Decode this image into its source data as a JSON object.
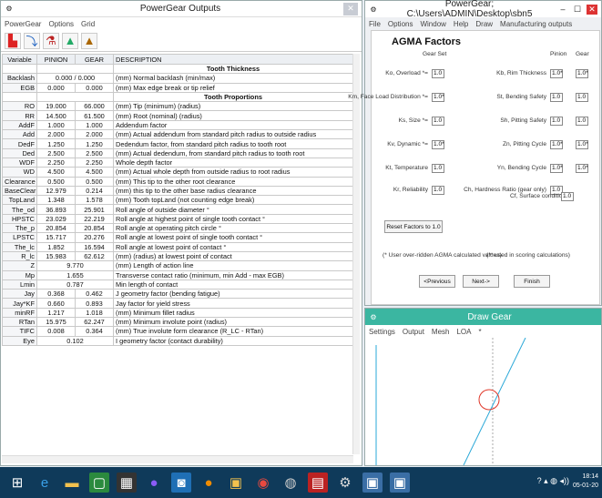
{
  "outputs_window": {
    "title": "PowerGear Outputs",
    "menu": [
      "PowerGear",
      "Options",
      "Grid"
    ],
    "toolbar_icons": [
      "gear-view-icon",
      "export-icon",
      "flask-icon",
      "tooth-chart-icon",
      "tooth-alt-icon"
    ],
    "columns": [
      "Variable",
      "PINION",
      "GEAR",
      "DESCRIPTION"
    ],
    "rows": [
      {
        "type": "section",
        "text": "Tooth Thickness"
      },
      {
        "var": "Backlash",
        "pinion": "0.000 / 0.000",
        "gear": "",
        "desc": "(mm) Normal backlash (min/max)",
        "span": true
      },
      {
        "var": "EGB",
        "pinion": "0.000",
        "gear": "0.000",
        "desc": "(mm) Max edge break or tip relief"
      },
      {
        "type": "section",
        "text": "Tooth Proportions"
      },
      {
        "var": "RO",
        "pinion": "19.000",
        "gear": "66.000",
        "desc": "(mm) Tip (minimum) (radius)"
      },
      {
        "var": "RR",
        "pinion": "14.500",
        "gear": "61.500",
        "desc": "(mm) Root (nominal) (radius)"
      },
      {
        "var": "AddF",
        "pinion": "1.000",
        "gear": "1.000",
        "desc": "Addendum factor"
      },
      {
        "var": "Add",
        "pinion": "2.000",
        "gear": "2.000",
        "desc": "(mm) Actual addendum from standard pitch radius to outside radius"
      },
      {
        "var": "DedF",
        "pinion": "1.250",
        "gear": "1.250",
        "desc": "Dedendum factor, from standard pitch radius to tooth root"
      },
      {
        "var": "Ded",
        "pinion": "2.500",
        "gear": "2.500",
        "desc": "(mm) Actual dedendum, from standard pitch radius to tooth root"
      },
      {
        "var": "WDF",
        "pinion": "2.250",
        "gear": "2.250",
        "desc": "Whole depth factor"
      },
      {
        "var": "WD",
        "pinion": "4.500",
        "gear": "4.500",
        "desc": "(mm) Actual whole depth from outside radius to root radius"
      },
      {
        "var": "Clearance",
        "pinion": "0.500",
        "gear": "0.500",
        "desc": "(mm) This tip to the other root clearance"
      },
      {
        "var": "BaseClear",
        "pinion": "12.979",
        "gear": "0.214",
        "desc": "(mm) this tip to the other base radius clearance"
      },
      {
        "var": "TopLand",
        "pinion": "1.348",
        "gear": "1.578",
        "desc": "(mm) Tooth topLand (not counting edge break)"
      },
      {
        "var": "The_od",
        "pinion": "36.893",
        "gear": "25.901",
        "desc": "Roll angle of outside diameter °"
      },
      {
        "var": "HPSTC",
        "pinion": "23.029",
        "gear": "22.219",
        "desc": "Roll angle at highest point of single tooth contact °"
      },
      {
        "var": "The_p",
        "pinion": "20.854",
        "gear": "20.854",
        "desc": "Roll angle at operating pitch circle °"
      },
      {
        "var": "LPSTC",
        "pinion": "15.717",
        "gear": "20.276",
        "desc": "Roll angle at lowest point of single tooth contact °"
      },
      {
        "var": "The_lc",
        "pinion": "1.852",
        "gear": "16.594",
        "desc": "Roll angle at lowest point of contact °"
      },
      {
        "var": "R_lc",
        "pinion": "15.983",
        "gear": "62.612",
        "desc": "(mm) (radius) at lowest point of contact"
      },
      {
        "var": "Z",
        "pinion": "9.770",
        "gear": "",
        "desc": "(mm) Length of action line",
        "span": true
      },
      {
        "var": "Mp",
        "pinion": "1.655",
        "gear": "",
        "desc": "Transverse contact ratio (minimum, min Add - max EGB)",
        "span": true
      },
      {
        "var": "Lmin",
        "pinion": "0.787",
        "gear": "",
        "desc": "Min length of contact",
        "span": true
      },
      {
        "var": "Jay",
        "pinion": "0.368",
        "gear": "0.462",
        "desc": "J geometry factor (bending fatigue)"
      },
      {
        "var": "Jay*KF",
        "pinion": "0.660",
        "gear": "0.893",
        "desc": "Jay factor for yield stress"
      },
      {
        "var": "minRF",
        "pinion": "1.217",
        "gear": "1.018",
        "desc": "(mm) Minimum fillet radius"
      },
      {
        "var": "RTan",
        "pinion": "15.975",
        "gear": "62.247",
        "desc": "(mm) Minimum involute point (radius)"
      },
      {
        "var": "TIFC",
        "pinion": "0.008",
        "gear": "0.364",
        "desc": "(mm) True involute form clearance (R_LC - RTan)"
      },
      {
        "var": "Eye",
        "pinion": "0.102",
        "gear": "",
        "desc": "I geometry factor (contact durability)",
        "span": true
      }
    ]
  },
  "agma_window": {
    "title": "PowerGear;  C:\\Users\\ADMIN\\Desktop\\sbn5",
    "menu": [
      "File",
      "Options",
      "Window",
      "Help",
      "Draw",
      "Manufacturing outputs"
    ],
    "heading": "AGMA Factors",
    "col_gear_set": "Gear Set",
    "col_pinion": "Pinion",
    "col_gear": "Gear",
    "left_fields": [
      {
        "label": "Ko, Overload *=",
        "value": "1.0"
      },
      {
        "label": "Km, Face Load Distribution *=",
        "value": "1.0*"
      },
      {
        "label": "Ks, Size *=",
        "value": "1.0"
      },
      {
        "label": "Kv, Dynamic *=",
        "value": "1.0*"
      },
      {
        "label": "Kt, Temperature",
        "value": "1.0"
      },
      {
        "label": "Kr, Reliability",
        "value": "1.0"
      }
    ],
    "right_fields": [
      {
        "label": "Kb, Rim Thickness",
        "pinion": "1.0*",
        "gear": "1.0*"
      },
      {
        "label": "St, Bending Safety",
        "pinion": "1.0",
        "gear": "1.0"
      },
      {
        "label": "Sh, Pitting Safety",
        "pinion": "1.0",
        "gear": "1.0"
      },
      {
        "label": "Zn, Pitting Cycle",
        "pinion": "1.0*",
        "gear": "1.0*"
      },
      {
        "label": "Yn, Bending Cycle",
        "pinion": "1.0*",
        "gear": "1.0*"
      },
      {
        "label": "Ch, Hardness Ratio (gear only)",
        "pinion": "1.0",
        "gear": ""
      }
    ],
    "cf_label": "Cf, Surface condition **",
    "cf_value": "1.0",
    "reset_label": "Reset Factors to 1.0",
    "note1": "(* User over-ridden AGMA calculated values)",
    "note2": "(** used in scoring calculations)",
    "prev_label": "<Previous",
    "next_label": "Next->",
    "finish_label": "Finish"
  },
  "draw_window": {
    "title": "Draw Gear",
    "menu": [
      "Settings",
      "Output",
      "Mesh",
      "LOA",
      "*"
    ]
  },
  "taskbar": {
    "time": "18:14",
    "date": "05-01-20"
  }
}
